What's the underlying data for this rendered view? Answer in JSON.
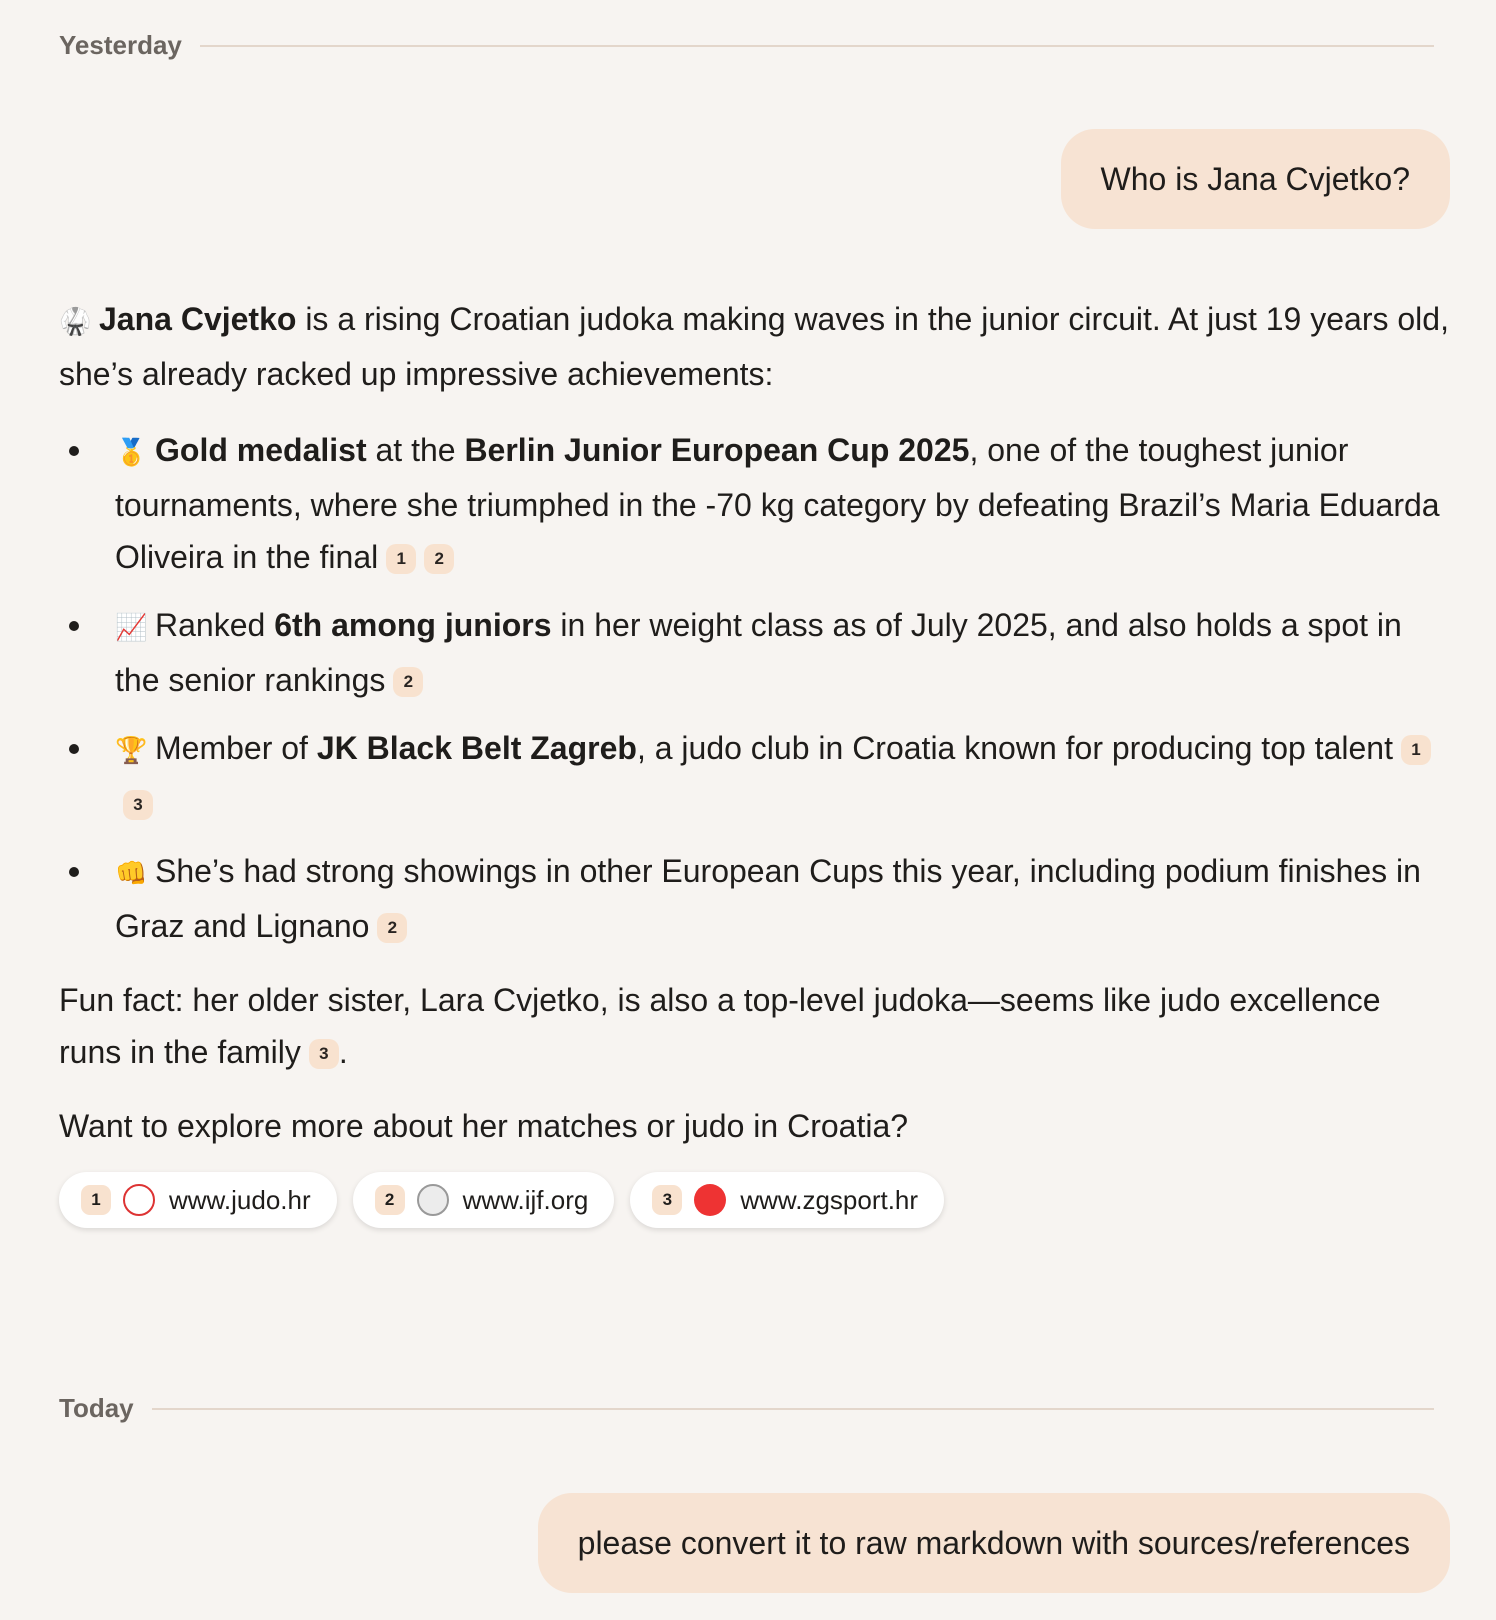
{
  "dividers": {
    "yesterday": "Yesterday",
    "today": "Today"
  },
  "messages": {
    "user1": "Who is Jana Cvjetko?",
    "user2": "please convert it to raw markdown with sources/references"
  },
  "answer": {
    "intro_emoji": "🥋",
    "intro_bold": "Jana Cvjetko",
    "intro_text": " is a rising Croatian judoka making waves in the junior circuit. At just 19 years old, she’s already racked up impressive achievements:",
    "bullets": [
      {
        "emoji": "🥇",
        "b1": "Gold medalist",
        "t1": " at the ",
        "b2": "Berlin Junior European Cup 2025",
        "t2": ", one of the toughest junior tournaments, where she triumphed in the -70 kg category by defeating Brazil’s Maria Eduarda Oliveira in the final",
        "cites": [
          "1",
          "2"
        ]
      },
      {
        "emoji": "📈",
        "t0": "Ranked ",
        "b1": "6th among juniors",
        "t1": " in her weight class as of July 2025, and also holds a spot in the senior rankings",
        "cites": [
          "2"
        ]
      },
      {
        "emoji": "🏆",
        "t0": "Member of ",
        "b1": "JK Black Belt Zagreb",
        "t1": ", a judo club in Croatia known for producing top talent",
        "cites": [
          "1",
          "3"
        ]
      },
      {
        "emoji": "👊",
        "t0": "She’s had strong showings in other European Cups this year, including podium finishes in Graz and Lignano",
        "cites": [
          "2"
        ]
      }
    ],
    "fun_fact": "Fun fact: her older sister, Lara Cvjetko, is also a top-level judoka—seems like judo excellence runs in the family",
    "fun_fact_cite": "3",
    "fun_fact_end": ".",
    "closing": "Want to explore more about her matches or judo in Croatia?"
  },
  "sources": [
    {
      "num": "1",
      "domain": "www.judo.hr",
      "icon": "judo-hr-favicon"
    },
    {
      "num": "2",
      "domain": "www.ijf.org",
      "icon": "ijf-favicon"
    },
    {
      "num": "3",
      "domain": "www.zgsport.hr",
      "icon": "zgsport-favicon"
    }
  ]
}
